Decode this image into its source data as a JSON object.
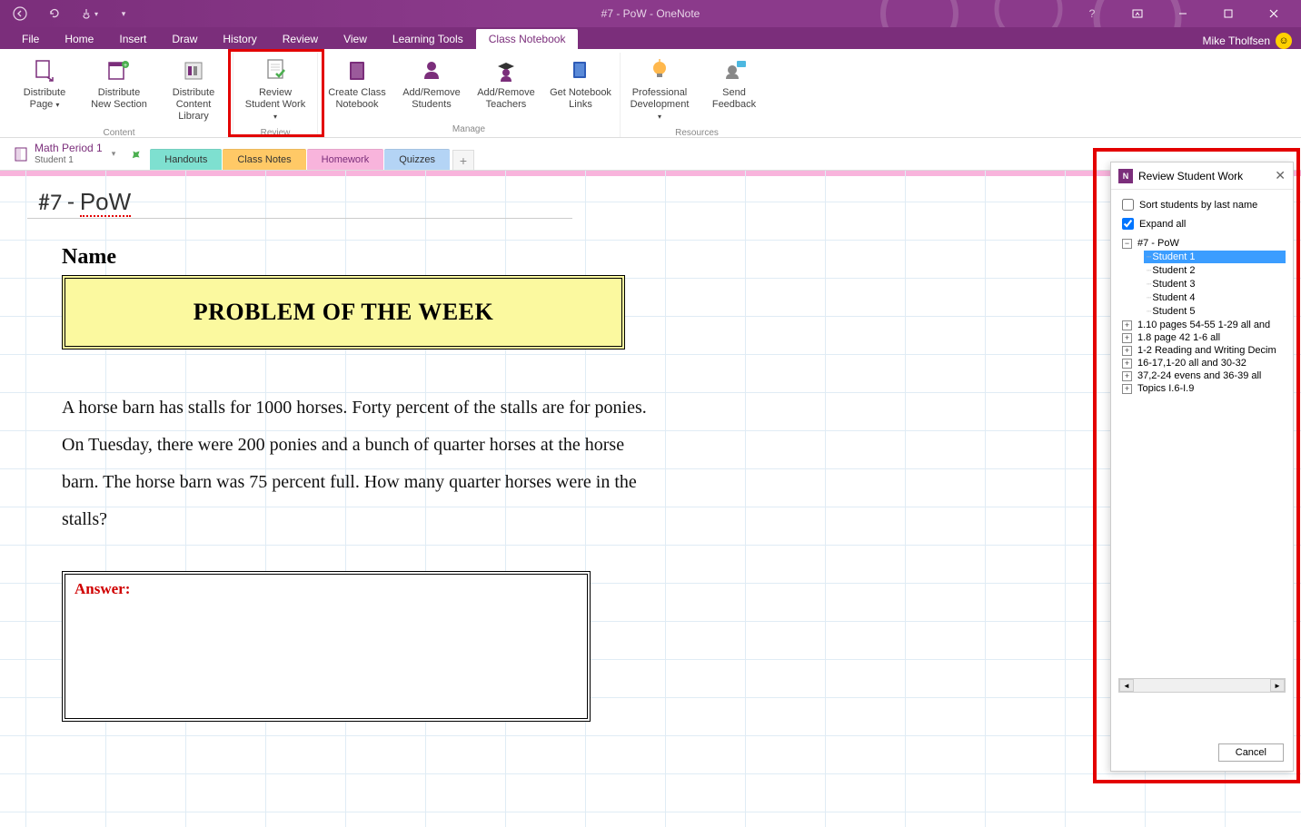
{
  "titlebar": {
    "title": "#7 - PoW - OneNote",
    "user": "Mike Tholfsen"
  },
  "menu": {
    "tabs": [
      "File",
      "Home",
      "Insert",
      "Draw",
      "History",
      "Review",
      "View",
      "Learning Tools",
      "Class Notebook"
    ],
    "active": "Class Notebook"
  },
  "ribbon": {
    "groups": [
      {
        "label": "Content",
        "items": [
          {
            "label": "Distribute Page",
            "dropdown": true
          },
          {
            "label": "Distribute New Section"
          },
          {
            "label": "Distribute Content Library"
          }
        ]
      },
      {
        "label": "Review",
        "items": [
          {
            "label": "Review Student Work",
            "dropdown": true
          }
        ],
        "highlighted": true
      },
      {
        "label": "Manage",
        "items": [
          {
            "label": "Create Class Notebook"
          },
          {
            "label": "Add/Remove Students"
          },
          {
            "label": "Add/Remove Teachers"
          },
          {
            "label": "Get Notebook Links"
          }
        ]
      },
      {
        "label": "Resources",
        "items": [
          {
            "label": "Professional Development",
            "dropdown": true
          },
          {
            "label": "Send Feedback"
          }
        ]
      }
    ]
  },
  "notebook": {
    "name": "Math Period 1",
    "sub": "Student 1"
  },
  "sections": [
    {
      "name": "Handouts",
      "class": "handouts"
    },
    {
      "name": "Class Notes",
      "class": "classnotes"
    },
    {
      "name": "Homework",
      "class": "homework",
      "active": true
    },
    {
      "name": "Quizzes",
      "class": "quizzes"
    }
  ],
  "page": {
    "title": "#7 - PoW",
    "name_label": "Name",
    "pow_heading": "PROBLEM OF THE WEEK",
    "problem": "A horse barn has stalls for 1000 horses. Forty percent of the stalls are for ponies. On Tuesday, there were 200 ponies and a bunch of quarter horses at the horse barn. The horse barn was 75 percent full. How many quarter horses were in the stalls?",
    "answer_label": "Answer:"
  },
  "panel": {
    "title": "Review Student Work",
    "sort_label": "Sort students by last name",
    "sort_checked": false,
    "expand_label": "Expand all",
    "expand_checked": true,
    "tree": {
      "root": "#7 - PoW",
      "students": [
        "Student 1",
        "Student 2",
        "Student 3",
        "Student 4",
        "Student 5"
      ],
      "selected": "Student 1",
      "other_pages": [
        "1.10 pages 54-55 1-29 all and",
        "1.8 page 42 1-6 all",
        "1-2 Reading and Writing Decim",
        "16-17,1-20 all and 30-32",
        "37,2-24 evens and 36-39 all",
        "Topics I.6-I.9"
      ]
    },
    "cancel": "Cancel"
  }
}
